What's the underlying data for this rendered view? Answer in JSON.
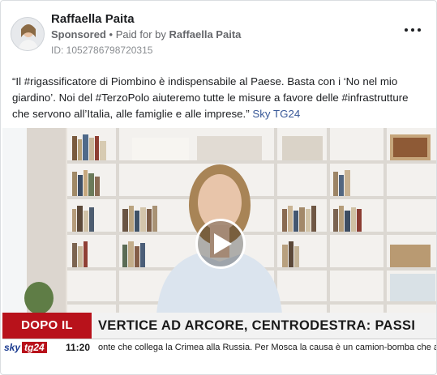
{
  "post": {
    "author_name": "Raffaella Paita",
    "sponsored_label": "Sponsored",
    "separator": "•",
    "paid_for_prefix": "Paid for by",
    "paid_for_name": "Raffaella Paita",
    "ad_id": "ID: 1052786798720315",
    "caption_text": "“Il #rigassificatore di Piombino è indispensabile al Paese. Basta con i ‘No nel mio giardino’. Noi del #TerzoPolo aiuteremo tutte le misure a favore delle #infrastrutture che servono all’Italia, alle famiglie e alle imprese.”",
    "caption_source": "Sky TG24"
  },
  "video": {
    "banner_label": "DOPO IL VOTO",
    "banner_headline": "VERTICE AD ARCORE, CENTRODESTRA: PASSI AVANTI",
    "channel_logo_sky": "sky",
    "channel_logo_tg": "tg24",
    "clock": "11:20",
    "ticker_text": "onte che collega la Crimea alla Russia. Per Mosca la causa è un camion-bomba che avrebbe pro"
  },
  "icons": {
    "more": "more-options-icon",
    "play": "play-icon"
  },
  "colors": {
    "banner_red": "#b8121b",
    "link_blue": "#385898"
  }
}
